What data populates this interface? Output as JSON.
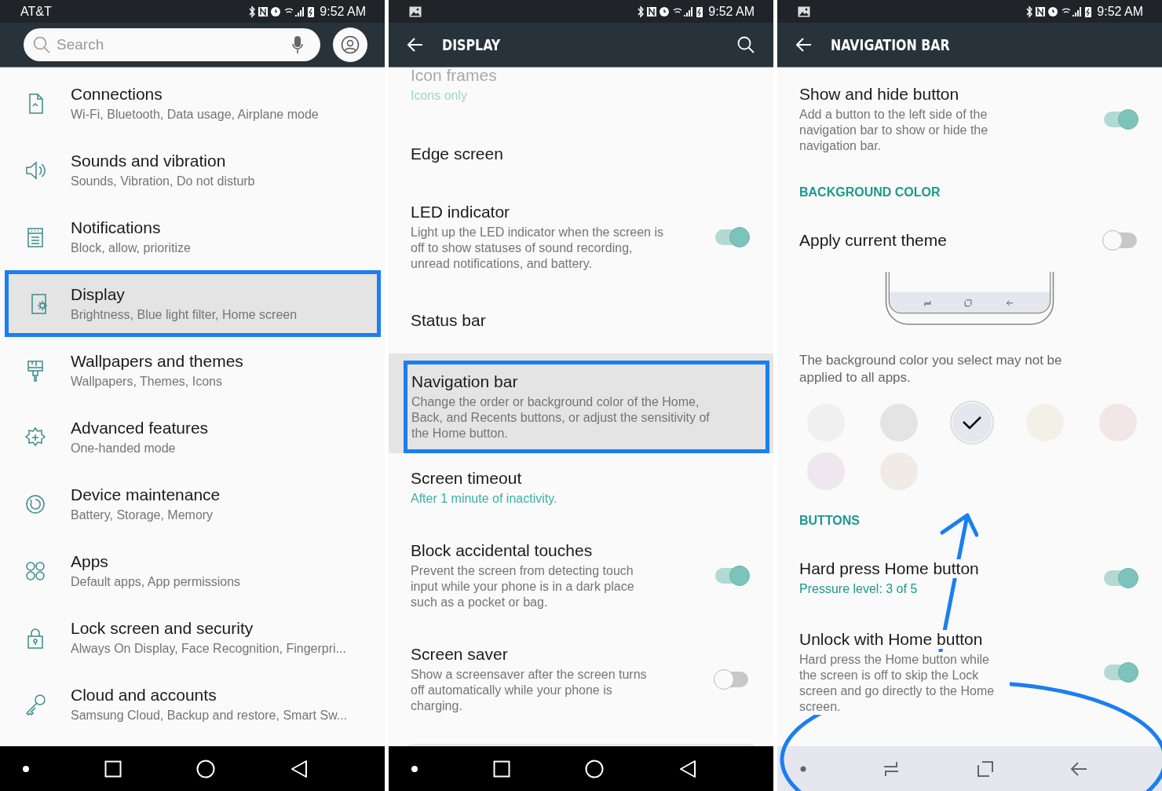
{
  "settings_screen": {
    "status_bar": {
      "carrier": "AT&T",
      "time": "9:52 AM"
    },
    "search": {
      "placeholder": "Search"
    },
    "items": [
      {
        "title": "Connections",
        "subtitle": "Wi-Fi, Bluetooth, Data usage, Airplane mode",
        "selected": false
      },
      {
        "title": "Sounds and vibration",
        "subtitle": "Sounds, Vibration, Do not disturb",
        "selected": false
      },
      {
        "title": "Notifications",
        "subtitle": "Block, allow, prioritize",
        "selected": false
      },
      {
        "title": "Display",
        "subtitle": "Brightness, Blue light filter, Home screen",
        "selected": true
      },
      {
        "title": "Wallpapers and themes",
        "subtitle": "Wallpapers, Themes, Icons",
        "selected": false
      },
      {
        "title": "Advanced features",
        "subtitle": "One-handed mode",
        "selected": false
      },
      {
        "title": "Device maintenance",
        "subtitle": "Battery, Storage, Memory",
        "selected": false
      },
      {
        "title": "Apps",
        "subtitle": "Default apps, App permissions",
        "selected": false
      },
      {
        "title": "Lock screen and security",
        "subtitle": "Always On Display, Face Recognition, Fingerpri...",
        "selected": false
      },
      {
        "title": "Cloud and accounts",
        "subtitle": "Samsung Cloud, Backup and restore, Smart Sw...",
        "selected": false
      }
    ],
    "nav_bar": {
      "kind": "dark"
    }
  },
  "display_screen": {
    "status_bar": {
      "time": "9:52 AM"
    },
    "title": "DISPLAY",
    "items": [
      {
        "kind": "summary",
        "title": "Icon frames",
        "subtitle": "Icons only",
        "disabled": true,
        "selected": false
      },
      {
        "kind": "plain",
        "title": "Edge screen",
        "disabled": false,
        "selected": false
      },
      {
        "kind": "toggle",
        "title": "LED indicator",
        "subtitle": "Light up the LED indicator when the screen is off to show statuses of sound recording, unread notifications, and battery.",
        "on": true,
        "disabled": false,
        "selected": false
      },
      {
        "kind": "plain",
        "title": "Status bar",
        "disabled": false,
        "selected": false
      },
      {
        "kind": "description",
        "title": "Navigation bar",
        "subtitle": "Change the order or background color of the Home, Back, and Recents buttons, or adjust the sensitivity of the Home button.",
        "disabled": false,
        "selected": true
      },
      {
        "kind": "summary",
        "title": "Screen timeout",
        "subtitle": "After 1 minute of inactivity.",
        "disabled": false,
        "selected": false
      },
      {
        "kind": "toggle",
        "title": "Block accidental touches",
        "subtitle": "Prevent the screen from detecting touch input while your phone is in a dark place such as a pocket or bag.",
        "on": true,
        "disabled": false,
        "selected": false
      },
      {
        "kind": "toggle",
        "title": "Screen saver",
        "subtitle": "Show a screensaver after the screen turns off automatically while your phone is charging.",
        "on": false,
        "disabled": false,
        "selected": false
      }
    ],
    "nav_bar": {
      "kind": "dark"
    }
  },
  "navigation_bar_screen": {
    "status_bar": {
      "time": "9:52 AM"
    },
    "title": "NAVIGATION BAR",
    "sections": [
      {
        "kind": "toggle",
        "title": "Show and hide button",
        "subtitle": "Add a button to the left side of the navigation bar to show or hide the navigation bar.",
        "on": true
      },
      {
        "kind": "header",
        "title": "BACKGROUND COLOR"
      },
      {
        "kind": "toggle",
        "title": "Apply current theme",
        "on": false
      },
      {
        "kind": "preview"
      },
      {
        "kind": "note",
        "text": "The background color you select may not be applied to all apps."
      },
      {
        "kind": "swatches",
        "swatches": [
          {
            "color": "#f0f0f0",
            "selected": false
          },
          {
            "color": "#e4e4e4",
            "selected": false
          },
          {
            "color": "#e6e6ef",
            "selected": true
          },
          {
            "color": "#f1f1e8",
            "selected": false
          },
          {
            "color": "#f2e6e6",
            "selected": false
          },
          {
            "color": "#efe6f0",
            "selected": false
          },
          {
            "color": "#f0ebe6",
            "selected": false
          }
        ]
      },
      {
        "kind": "header",
        "title": "BUTTONS"
      },
      {
        "kind": "toggle_summary",
        "title": "Hard press Home button",
        "subtitle": "Pressure level: 3 of 5",
        "on": true
      },
      {
        "kind": "toggle",
        "title": "Unlock with Home button",
        "subtitle": "Hard press the Home button while the screen is off to skip the Lock screen and go directly to the Home screen.",
        "on": true
      }
    ],
    "nav_bar": {
      "kind": "light"
    }
  }
}
